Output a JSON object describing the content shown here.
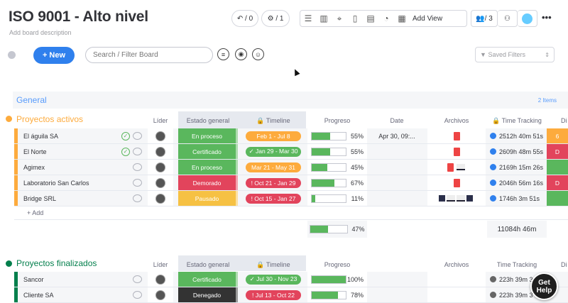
{
  "board": {
    "title": "ISO 9001 - Alto nivel",
    "description": "Add board description",
    "undo_count": "/ 0",
    "bot_count": "/ 1",
    "add_view": "Add View",
    "members": "/ 3",
    "more": "•••"
  },
  "toolbar": {
    "new_label": "+ New",
    "search_placeholder": "Search / Filter Board",
    "saved_filters": "Saved Filters"
  },
  "general": {
    "name": "General",
    "count": "2 Items"
  },
  "group1": {
    "name": "Proyectos activos",
    "color": "#fdab3d",
    "columns": [
      "Líder",
      "Estado general",
      "Timeline",
      "Progreso",
      "Date",
      "Archivos",
      "Time Tracking",
      "Di"
    ],
    "rows": [
      {
        "name": "El águila SA",
        "status": "En proceso",
        "status_color": "#5ab75d",
        "timeline": "Feb 1 - Jul 8",
        "tl_color": "#fdab3d",
        "progress": 55,
        "progress_label": "55%",
        "date": "Apr 30, 09:...",
        "files": "pdf",
        "time": "2512h 40m 51s",
        "extra_color": "#fdab3d",
        "extra": "6"
      },
      {
        "name": "El Norte",
        "status": "Certificado",
        "status_color": "#5ab75d",
        "timeline": "✓ Jan 29 - Mar 30",
        "tl_color": "#5ab75d",
        "progress": 55,
        "progress_label": "55%",
        "date": "",
        "files": "pdf",
        "time": "2609h 48m 55s",
        "extra_color": "#e2445c",
        "extra": "D"
      },
      {
        "name": "Agimex",
        "status": "En proceso",
        "status_color": "#5ab75d",
        "timeline": "Mar 21 - May 31",
        "tl_color": "#fdab3d",
        "progress": 45,
        "progress_label": "45%",
        "date": "",
        "files": "pdf2",
        "time": "2169h 15m 26s",
        "extra_color": "#5ab75d",
        "extra": ""
      },
      {
        "name": "Laboratorio San Carlos",
        "status": "Demorado",
        "status_color": "#e2445c",
        "timeline": "! Oct 21 - Jan 29",
        "tl_color": "#e2445c",
        "progress": 67,
        "progress_label": "67%",
        "date": "",
        "files": "pdf",
        "time": "2046h 56m 16s",
        "extra_color": "#e2445c",
        "extra": "D"
      },
      {
        "name": "Bridge SRL",
        "status": "Pausado",
        "status_color": "#f6c143",
        "timeline": "! Oct 15 - Jan 27",
        "tl_color": "#e2445c",
        "progress": 11,
        "progress_label": "11%",
        "date": "",
        "files": "thumbs",
        "time": "1746h 3m 51s",
        "extra_color": "#5ab75d",
        "extra": ""
      }
    ],
    "add_label": "+ Add",
    "summary_progress": 47,
    "summary_progress_label": "47%",
    "summary_time": "11084h 46m"
  },
  "group2": {
    "name": "Proyectos finalizados",
    "color": "#037f4c",
    "columns": [
      "Líder",
      "Estado general",
      "Timeline",
      "Progreso",
      "Archivos",
      "Time Tracking",
      "Di"
    ],
    "rows": [
      {
        "name": "Sancor",
        "status": "Certificado",
        "status_color": "#5ab75d",
        "timeline": "✓ Jul 30 - Nov 23",
        "tl_color": "#5ab75d",
        "progress": 100,
        "progress_label": "100%",
        "time": "223h 39m 3"
      },
      {
        "name": "Cliente SA",
        "status": "Denegado",
        "status_color": "#333333",
        "timeline": "! Jul 13 - Oct 22",
        "tl_color": "#e2445c",
        "progress": 78,
        "progress_label": "78%",
        "time": "223h 39m 3"
      }
    ]
  },
  "help": {
    "line1": "Get",
    "line2": "Help"
  }
}
